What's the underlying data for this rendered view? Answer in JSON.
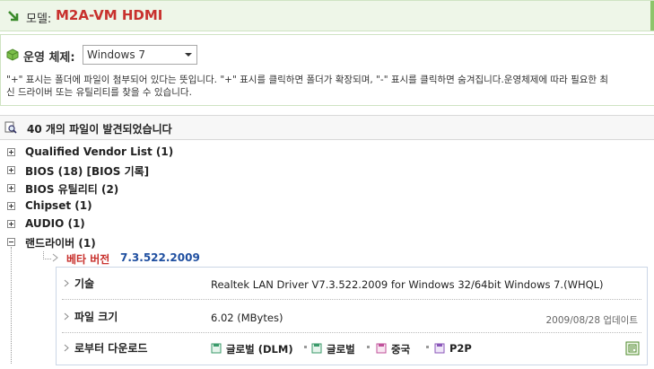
{
  "header": {
    "model_label": "모델:",
    "model_value": "M2A-VM HDMI"
  },
  "os": {
    "label": "운영 체제:",
    "selected": "Windows 7",
    "note_line1": "\"+\" 표시는 폴더에 파일이 첨부되어 있다는 뜻입니다. \"+\" 표시를 클릭하면 폴더가 확장되며, \"-\" 표시를 클릭하면 숨겨집니다.운영체제에 따라 필요한 최",
    "note_line2": "신 드라이버 또는 유틸리티를 찾을 수 있습니다."
  },
  "found": {
    "text": "40 개의 파일이 발견되었습니다"
  },
  "tree": [
    {
      "label": "Qualified Vendor List  (1)",
      "state": "plus"
    },
    {
      "label": "BIOS (18) [BIOS 기록]",
      "state": "plus"
    },
    {
      "label": "BIOS 유틸리티   (2)",
      "state": "plus"
    },
    {
      "label": "Chipset (1)",
      "state": "plus"
    },
    {
      "label": "AUDIO (1)",
      "state": "plus"
    },
    {
      "label": "랜드라이버  (1)",
      "state": "minus"
    }
  ],
  "beta": {
    "label": "베타 버전",
    "version": "7.3.522.2009"
  },
  "detail": {
    "desc_key": "기술",
    "desc_value": "Realtek LAN Driver V7.3.522.2009 for Windows 32/64bit Windows 7.(WHQL)",
    "size_key": "파일 크기",
    "size_value": "6.02 (MBytes)",
    "updated": "2009/08/28 업데이트",
    "download_key": "로부터 다운로드",
    "downloads": [
      {
        "label": "글로벌 (DLM)",
        "color": "#3a9a6a"
      },
      {
        "label": "글로벌",
        "color": "#3a9a6a"
      },
      {
        "label": "중국",
        "color": "#c0509a"
      },
      {
        "label": "P2P",
        "color": "#8a56b8"
      }
    ]
  },
  "colors": {
    "accent_red": "#c8312d",
    "accent_blue": "#1f4fa0",
    "bar_green": "#eef6e8"
  }
}
